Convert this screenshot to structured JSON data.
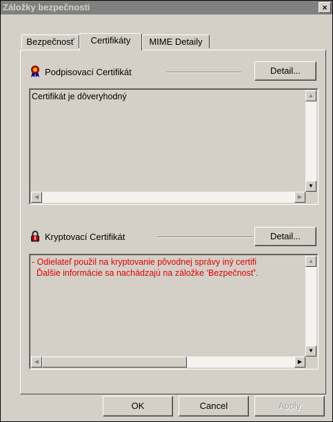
{
  "window": {
    "title": "Záložky bezpečnosti",
    "close_label": "×"
  },
  "tabs": [
    {
      "label": "Bezpečnosť",
      "active": false
    },
    {
      "label": "Certifikáty",
      "active": true
    },
    {
      "label": "MIME Detaily",
      "active": false
    }
  ],
  "signing": {
    "label": "Podpisovací Certifikát",
    "detail_button": "Detail...",
    "icon": "certificate-ribbon-icon",
    "text_lines": [
      "Certifikát je dôveryhodný"
    ]
  },
  "encryption": {
    "label": "Kryptovací Certifikát",
    "detail_button": "Detail...",
    "icon": "lock-warning-icon",
    "text_lines": [
      "- Odielateľ použil na kryptovanie pôvodnej správy iný certifi",
      "  Ďalšie informácie sa nachádzajú na záložke 'Bezpečnosť'."
    ],
    "text_color": "#e00000"
  },
  "buttons": {
    "ok": "OK",
    "cancel": "Cancel",
    "apply": "Apply"
  },
  "scroll_arrows": {
    "up": "▲",
    "down": "▼",
    "left": "◀",
    "right": "▶"
  }
}
